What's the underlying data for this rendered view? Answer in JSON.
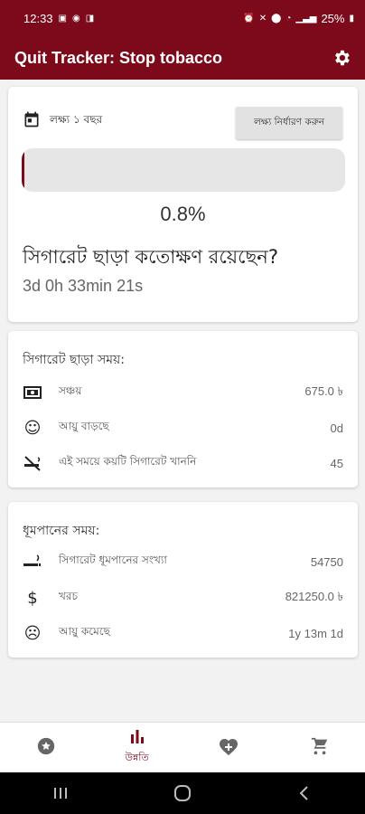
{
  "status": {
    "time": "12:33",
    "battery": "25%"
  },
  "app": {
    "title": "Quit Tracker: Stop tobacco",
    "accent": "#7c0a1a"
  },
  "goal": {
    "label": "লক্ষ্য ১ বছর",
    "button": "লক্ষ্য নির্ধারণ করুন",
    "progress_percent_text": "0.8%",
    "progress_fraction": 0.008
  },
  "smoke_free": {
    "question": "সিগারেট ছাড়া কতোক্ষণ রয়েছেন?",
    "elapsed": "3d 0h 33min 21s"
  },
  "without_section": {
    "title": "সিগারেট ছাড়া সময়:",
    "rows": [
      {
        "label": "সঞ্চয়",
        "value": "675.0 ৳",
        "icon": "money-icon"
      },
      {
        "label": "আয়ু বাড়ছে",
        "value": "0d",
        "icon": "smile-icon"
      },
      {
        "label": "এই সময়ে কয়টি সিগারেট খাননি",
        "value": "45",
        "icon": "no-smoking-icon"
      }
    ]
  },
  "smoking_section": {
    "title": "ধূমপানের সময়:",
    "rows": [
      {
        "label": "সিগারেট ধূমপানের সংখ্যা",
        "value": "54750",
        "icon": "smoking-icon"
      },
      {
        "label": "খরচ",
        "value": "821250.0 ৳",
        "icon": "dollar-icon"
      },
      {
        "label": "আয়ু কমেছে",
        "value": "1y 13m 1d",
        "icon": "sad-icon"
      }
    ]
  },
  "nav": {
    "progress_label": "উন্নতি",
    "items": [
      "star-icon",
      "bar-chart-icon",
      "heart-icon",
      "cart-icon"
    ]
  }
}
